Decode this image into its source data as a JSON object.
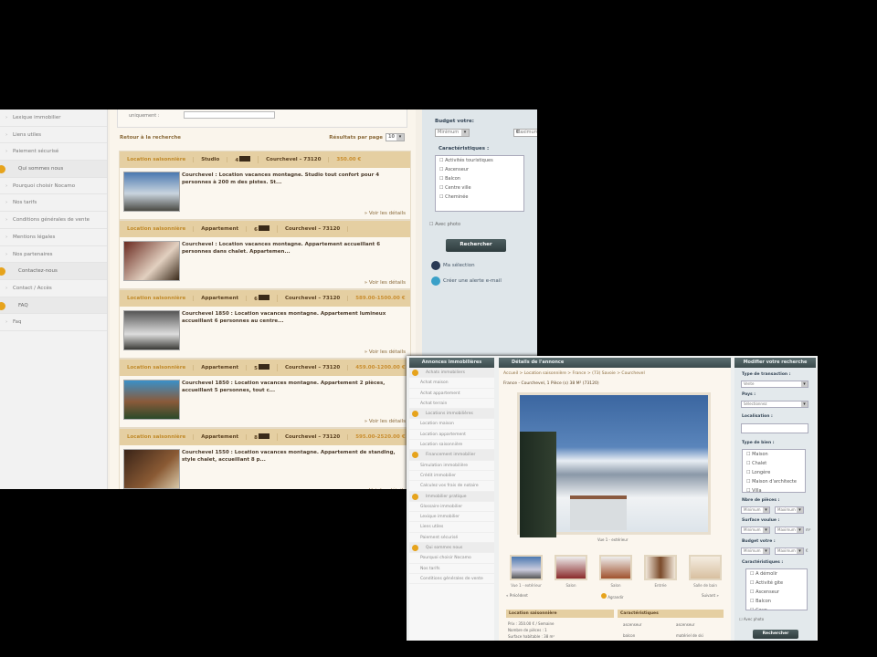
{
  "shotA": {
    "sidebar": [
      {
        "label": "Lexique immobilier",
        "section": false
      },
      {
        "label": "Liens utiles",
        "section": false
      },
      {
        "label": "Paiement sécurisé",
        "section": false
      },
      {
        "label": "Qui sommes nous",
        "section": true
      },
      {
        "label": "Pourquoi choisir Nocamo",
        "section": false
      },
      {
        "label": "Nos tarifs",
        "section": false
      },
      {
        "label": "Conditions générales de vente",
        "section": false
      },
      {
        "label": "Mentions légales",
        "section": false
      },
      {
        "label": "Nos partenaires",
        "section": false
      },
      {
        "label": "Contactez-nous",
        "section": true
      },
      {
        "label": "Contact / Accès",
        "section": false
      },
      {
        "label": "FAQ",
        "section": true
      },
      {
        "label": "Faq",
        "section": false
      }
    ],
    "top_label": "uniquement :",
    "back_link": "Retour à la recherche",
    "per_page_label": "Résultats par page",
    "per_page_value": "10",
    "results": [
      {
        "category": "Location saisonnière",
        "type": "Studio",
        "beds": "4",
        "place": "Courchevel – 73120",
        "price": "350.00 €",
        "desc": "Courchevel : Location vacances montagne. Studio tout confort pour 4 personnes à 200 m des pistes. St...",
        "more": "» Voir les détails"
      },
      {
        "category": "Location saisonnière",
        "type": "Appartement",
        "beds": "6",
        "place": "Courchevel – 73120",
        "price": "",
        "desc": "Courchevel : Location vacances montagne. Appartement accueillant 6 personnes dans chalet. Appartemen...",
        "more": "» Voir les détails"
      },
      {
        "category": "Location saisonnière",
        "type": "Appartement",
        "beds": "6",
        "place": "Courchevel – 73120",
        "price": "589.00-1500.00 €",
        "desc": "Courchevel 1850 : Location vacances montagne. Appartement lumineux accueillant 6 personnes au centre...",
        "more": "» Voir les détails"
      },
      {
        "category": "Location saisonnière",
        "type": "Appartement",
        "beds": "5",
        "place": "Courchevel – 73120",
        "price": "459.00-1200.00 €",
        "desc": "Courchevel 1850 : Location vacances montagne. Appartement 2 pièces, accueillant 5 personnes, tout c...",
        "more": "» Voir les détails"
      },
      {
        "category": "Location saisonnière",
        "type": "Appartement",
        "beds": "8",
        "place": "Courchevel – 73120",
        "price": "595.00-2520.00 €",
        "desc": "Courchevel 1550 : Location vacances montagne. Appartement de standing, style chalet, accueillant 8 p...",
        "more": "» Voir les détails"
      }
    ],
    "right": {
      "budget_label": "Budget votre:",
      "min": "Minimum",
      "max": "Maximum",
      "currency": "€",
      "features_label": "Caractéristiques :",
      "features": [
        "Activités touristiques",
        "Ascenseur",
        "Balcon",
        "Centre ville",
        "Cheminée"
      ],
      "photo_label": "Avec photo",
      "search_button": "Rechercher",
      "selection_link": "Ma sélection",
      "alert_link": "Créer une alerte e-mail"
    }
  },
  "shotB": {
    "sidebar_title": "Annonces immobilières",
    "sidebar": [
      {
        "label": "Achats immobiliers",
        "section": true
      },
      {
        "label": "Achat maison",
        "section": false
      },
      {
        "label": "Achat appartement",
        "section": false
      },
      {
        "label": "Achat terrain",
        "section": false
      },
      {
        "label": "Locations immobilières",
        "section": true
      },
      {
        "label": "Location maison",
        "section": false
      },
      {
        "label": "Location appartement",
        "section": false
      },
      {
        "label": "Location saisonnière",
        "section": false
      },
      {
        "label": "Financement immobilier",
        "section": true
      },
      {
        "label": "Simulation immobilière",
        "section": false
      },
      {
        "label": "Crédit immobilier",
        "section": false
      },
      {
        "label": "Calculez vos frais de notaire",
        "section": false
      },
      {
        "label": "Immobilier pratique",
        "section": true
      },
      {
        "label": "Glossaire immobilier",
        "section": false
      },
      {
        "label": "Lexique immobilier",
        "section": false
      },
      {
        "label": "Liens utiles",
        "section": false
      },
      {
        "label": "Paiement sécurisé",
        "section": false
      },
      {
        "label": "Qui sommes nous",
        "section": true
      },
      {
        "label": "Pourquoi choisir Nocamo",
        "section": false
      },
      {
        "label": "Nos tarifs",
        "section": false
      },
      {
        "label": "Conditions générales de vente",
        "section": false
      }
    ],
    "center_title": "Détails de l'annonce",
    "breadcrumb": "Accueil > Location saisonnière > France > (73) Savoie > Courchevel",
    "subtitle": "France - Courchevel, 1 Pièce (s) 38 M² (73120)",
    "main_caption": "Vue 1 - extérieur",
    "thumbs": [
      "Vue 1 - extérieur",
      "Salon",
      "Salon",
      "Entrée",
      "Salle de bain"
    ],
    "prev": "« Précédent",
    "next": "Suivant »",
    "enlarge": "Agrandir",
    "section1": "Location saisonnière",
    "section1_lines": [
      "Prix : 350.00 € / Semaine",
      "Nombre de pièces : 1",
      "Surface habitable : 38 m²"
    ],
    "section2": "Caractéristiques",
    "section2_items": [
      "ascenseur",
      "ascenseur",
      "balcon",
      "matériel de ski"
    ],
    "right_title": "Modifier votre recherche",
    "right": {
      "transaction_label": "Type de transaction :",
      "transaction_value": "Vente",
      "country_label": "Pays :",
      "country_value": "Sélectionnez",
      "location_label": "Localisation :",
      "type_label": "Type de bien :",
      "types": [
        "Maison",
        "Chalet",
        "Longère",
        "Maison d'architecte",
        "Villa"
      ],
      "rooms_label": "Nbre de pièces :",
      "surface_label": "Surface voulue :",
      "budget_label": "Budget votre :",
      "min": "Minimum",
      "max": "Maximum",
      "surface_unit": "m²",
      "currency": "€",
      "features_label": "Caractéristiques :",
      "features": [
        "A démolir",
        "Activité gite",
        "Ascenseur",
        "Balcon",
        "Cave"
      ],
      "photo_label": "Avec photo",
      "search_button": "Rechercher"
    }
  }
}
